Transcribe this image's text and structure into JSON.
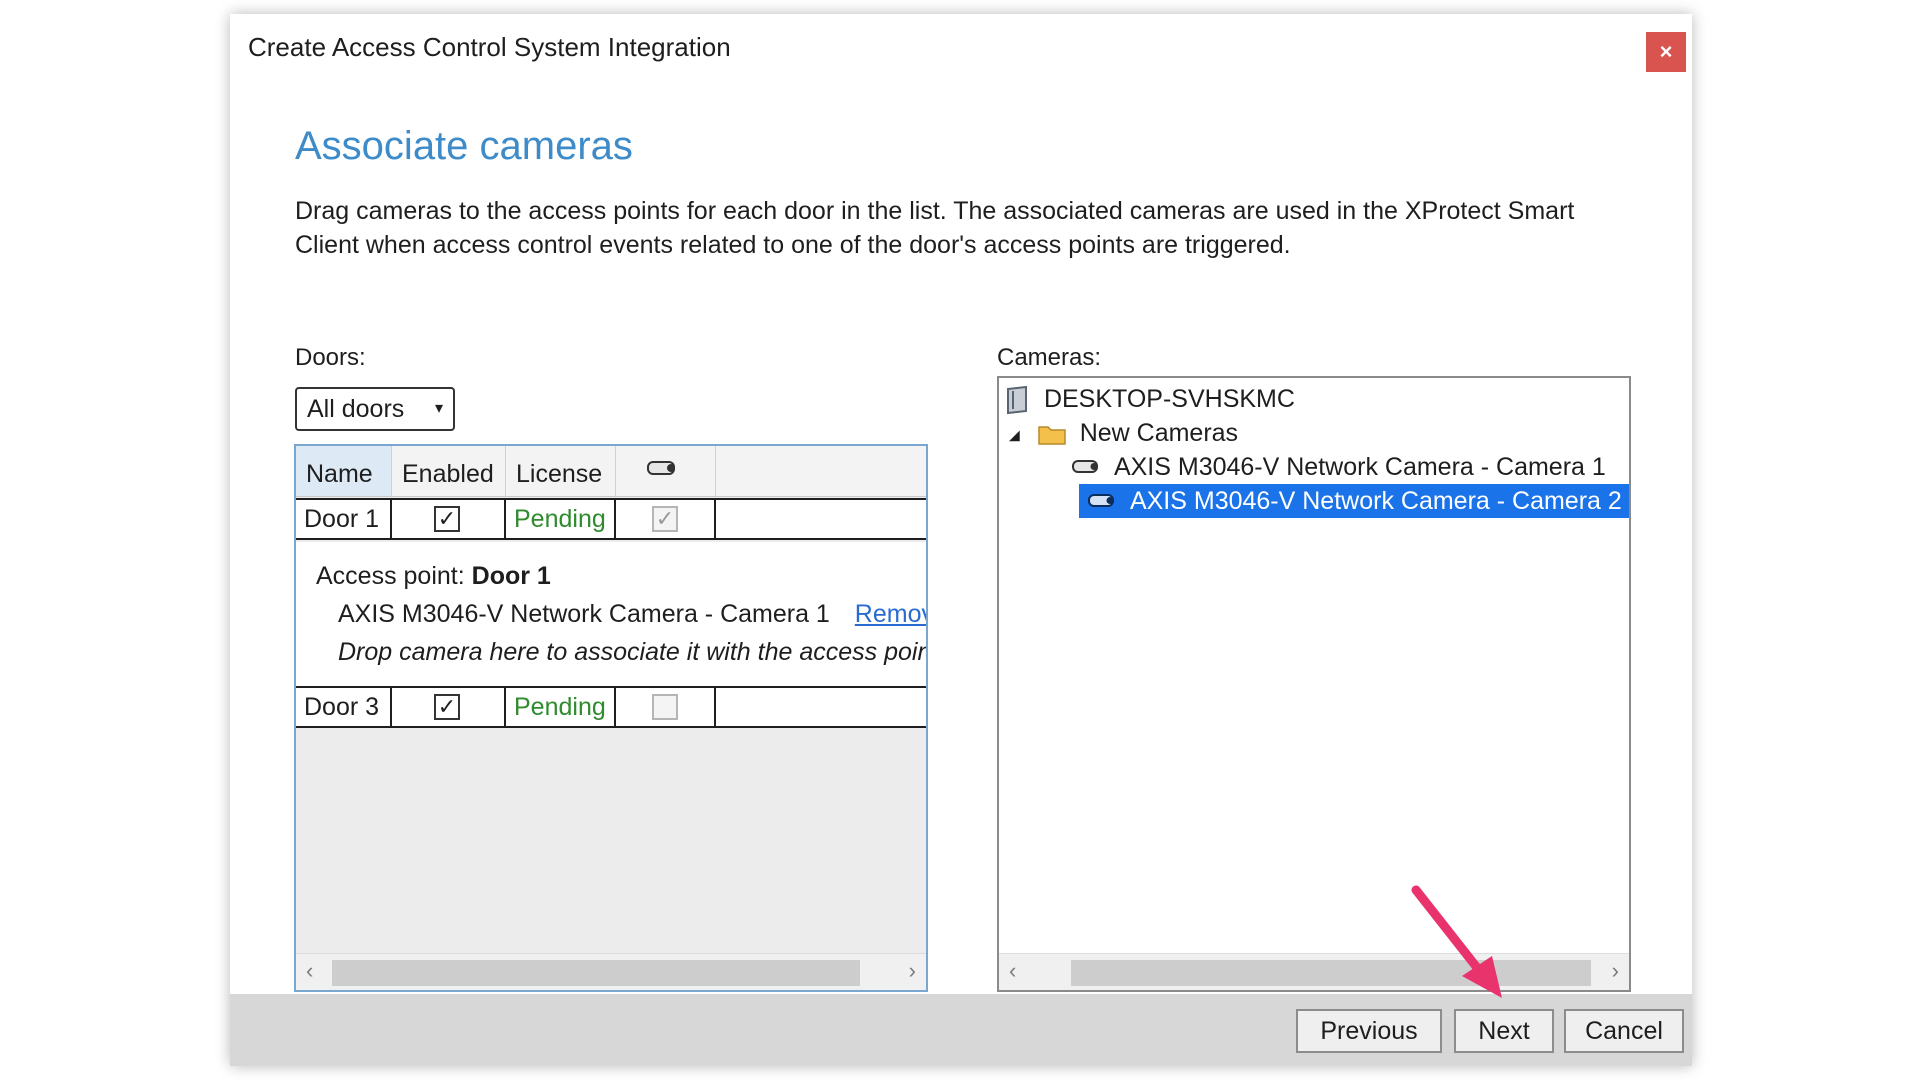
{
  "dialog": {
    "title": "Create Access Control System Integration",
    "close_label": "×"
  },
  "page": {
    "heading": "Associate cameras",
    "description": "Drag cameras to the access points for each door in the list. The associated cameras are used in the XProtect Smart Client when access control events related to one of the door's access points are triggered."
  },
  "doors": {
    "label": "Doors:",
    "filter_value": "All doors",
    "columns": [
      "Name",
      "Enabled",
      "License"
    ],
    "rows": [
      {
        "name": "Door 1",
        "enabled": true,
        "license": "Pending",
        "camera_check": true
      },
      {
        "name": "Door 3",
        "enabled": true,
        "license": "Pending",
        "camera_check": false
      }
    ],
    "detail": {
      "access_point_label": "Access point:",
      "access_point_name": "Door 1",
      "associated_camera": "AXIS M3046-V Network Camera - Camera 1",
      "remove_link": "Remov",
      "drop_hint": "Drop camera here to associate it with the access poin"
    }
  },
  "cameras": {
    "label": "Cameras:",
    "server": "DESKTOP-SVHSKMC",
    "group": "New Cameras",
    "items": [
      {
        "label": "AXIS M3046-V Network Camera - Camera 1",
        "selected": false
      },
      {
        "label": "AXIS M3046-V Network Camera - Camera 2",
        "selected": true
      }
    ]
  },
  "footer": {
    "previous": "Previous",
    "next": "Next",
    "cancel": "Cancel"
  },
  "colors": {
    "heading": "#3e8bc9",
    "pending": "#2e8b2e",
    "selection": "#1a73e8",
    "annotation_arrow": "#e8336d",
    "close_button": "#d9534f"
  },
  "icons": [
    "server-icon",
    "folder-icon",
    "camera-icon",
    "chevron-down-icon",
    "expand-triangle-icon",
    "close-icon"
  ]
}
